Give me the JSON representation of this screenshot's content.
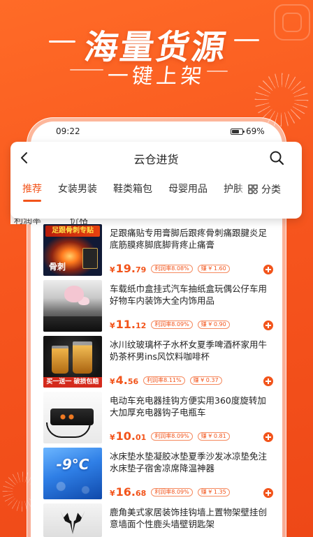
{
  "promo": {
    "headline": "海量货源",
    "subheadline": "一键上架"
  },
  "status_bar": {
    "time": "09:22",
    "battery": "69%"
  },
  "header": {
    "title": "云仓进货"
  },
  "tabs": [
    {
      "label": "推荐",
      "active": true
    },
    {
      "label": "女装男装",
      "active": false
    },
    {
      "label": "鞋类箱包",
      "active": false
    },
    {
      "label": "母婴用品",
      "active": false
    },
    {
      "label": "护肤",
      "active": false
    }
  ],
  "category_button": {
    "label": "分类"
  },
  "sort": [
    {
      "label": "利润率"
    },
    {
      "label": "价格"
    }
  ],
  "currency_symbol": "¥",
  "products": [
    {
      "title": "足跟痛贴专用膏脚后跟疼骨刺痛跟腱炎足底筋膜疼脚底脚背疼止痛膏",
      "price": "19.79",
      "profit_tag": "利润率8.08%",
      "earn_tag": "赚 ¥ 1.60",
      "image_labels": [
        "足跟骨刺专贴",
        "骨刺"
      ]
    },
    {
      "title": "车载纸巾盒挂式汽车抽纸盒玩偶公仔车用好物车内装饰大全内饰用品",
      "price": "11.12",
      "profit_tag": "利润率8.09%",
      "earn_tag": "赚 ¥ 0.90",
      "image_labels": []
    },
    {
      "title": "冰川纹玻璃杯子水杯女夏季啤酒杯家用牛奶茶杯男ins风饮料咖啡杯",
      "price": "4.56",
      "profit_tag": "利润率8.11%",
      "earn_tag": "赚 ¥ 0.37",
      "image_labels": [
        "买一送一 破损包赔"
      ]
    },
    {
      "title": "电动车充电器挂钩方便实用360度旋转加大加厚充电器钩子电瓶车",
      "price": "10.01",
      "profit_tag": "利润率8.09%",
      "earn_tag": "赚 ¥ 0.81",
      "image_labels": []
    },
    {
      "title": "冰床垫水垫凝胶冰垫夏季沙发冰凉垫免注水床垫子宿舍凉席降温神器",
      "price": "16.68",
      "profit_tag": "利润率8.09%",
      "earn_tag": "赚 ¥ 1.35",
      "image_labels": [
        "-9°C"
      ]
    },
    {
      "title": "鹿角美式家居装饰挂钩墙上置物架壁挂创意墙面个性鹿头墙壁钥匙架",
      "image_labels": []
    }
  ],
  "icons": {
    "back": "chevron-left-icon",
    "search": "search-icon",
    "category": "grid-icon",
    "battery": "battery-icon",
    "add": "plus-icon"
  },
  "colors": {
    "background": "#F7561E",
    "accent": "#F2541B"
  }
}
